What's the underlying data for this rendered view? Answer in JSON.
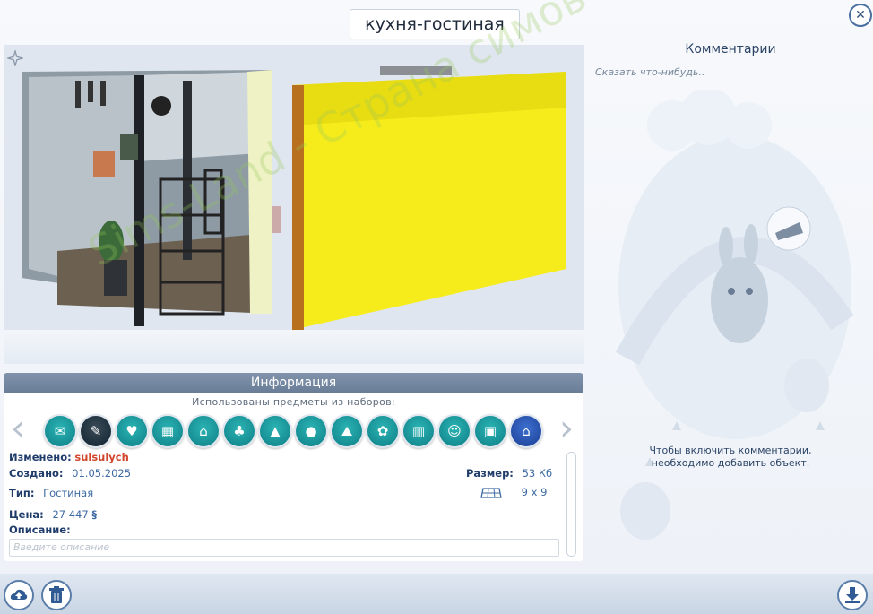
{
  "lot_name": "кухня-гостиная",
  "comments": {
    "title": "Комментарии",
    "placeholder": "Сказать что-нибудь..",
    "disabled_note_line1": "Чтобы включить комментарии,",
    "disabled_note_line2": "необходимо добавить объект."
  },
  "info": {
    "header": "Информация",
    "packs_label": "Использованы предметы из наборов:",
    "packs": [
      "pack-icon",
      "pack-icon",
      "pack-icon",
      "pack-icon",
      "pack-icon",
      "pack-icon",
      "pack-icon",
      "pack-icon",
      "pack-icon",
      "pack-icon",
      "pack-icon",
      "pack-icon",
      "pack-icon",
      "pack-icon",
      "pack-icon"
    ],
    "modified_label": "Изменено:",
    "modified_value": "sulsulych",
    "created_label": "Создано:",
    "created_value": "01.05.2025",
    "type_label": "Тип:",
    "type_value": "Гостиная",
    "price_label": "Цена:",
    "price_value": "27 447",
    "price_currency": "§",
    "description_label": "Описание:",
    "description_placeholder": "Введите описание",
    "size_label": "Размер:",
    "size_value": "53 Кб",
    "dimensions_value": "9 x 9"
  },
  "watermark": "Sims-Land - Страна симов",
  "colors": {
    "accent": "#2b4f80",
    "pack_teal": "#13868c",
    "modified_red": "#d2452d",
    "header_bar": "#7487a0"
  }
}
